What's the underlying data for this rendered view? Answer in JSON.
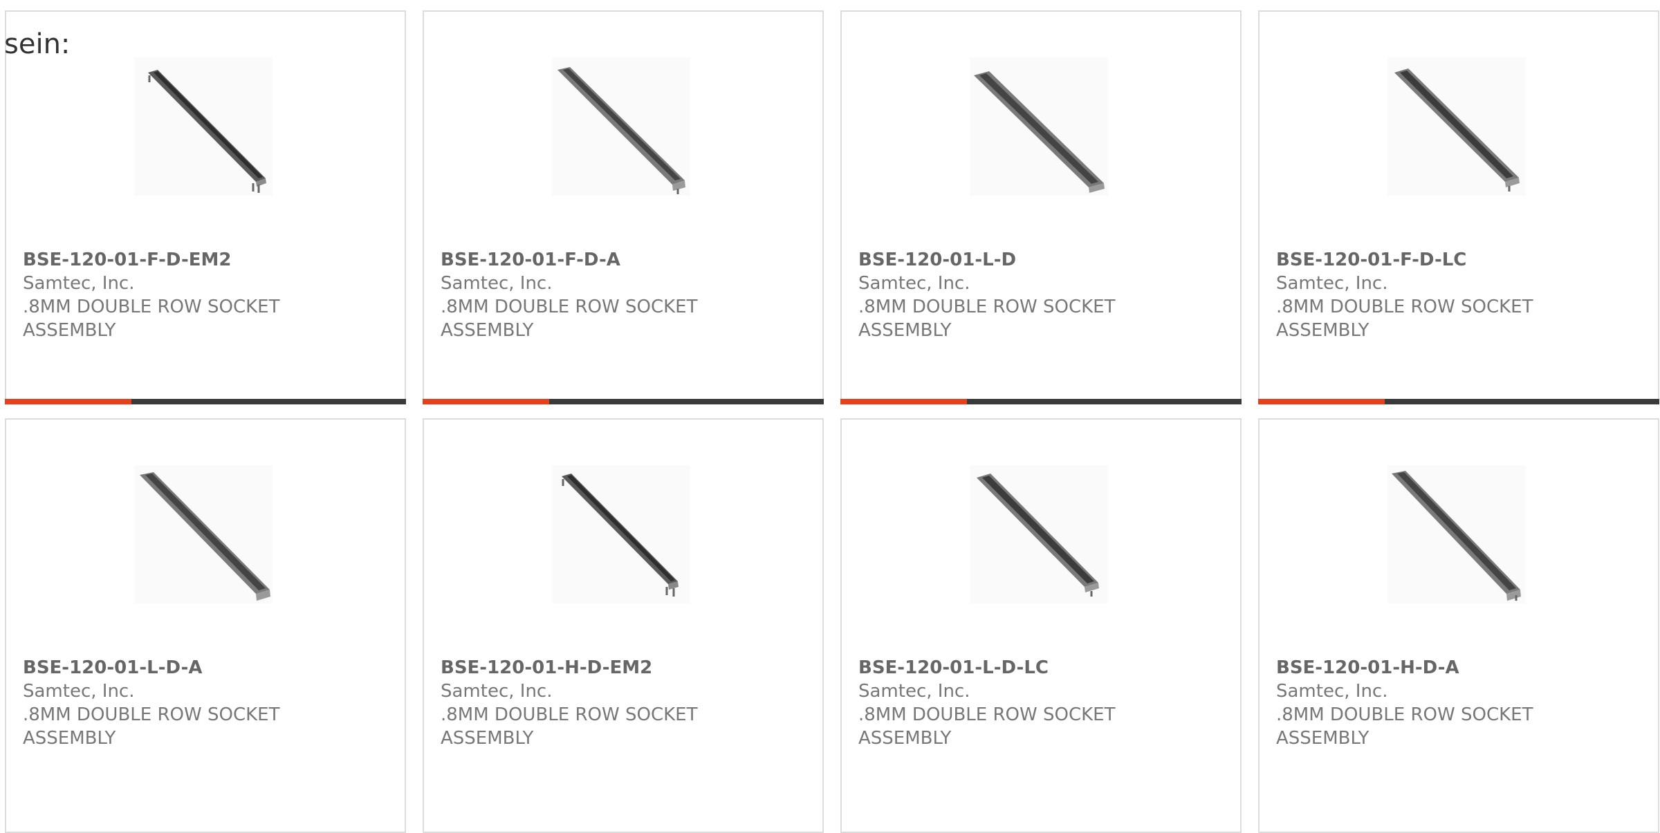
{
  "intro_text": "sein:",
  "accent_color": "#e8401c",
  "bar_color": "#3a3a3a",
  "products": [
    {
      "part_number": "BSE-120-01-F-D-EM2",
      "manufacturer": "Samtec, Inc.",
      "description": ".8MM DOUBLE ROW SOCKET ASSEMBLY",
      "image": "socket-connector-image"
    },
    {
      "part_number": "BSE-120-01-F-D-A",
      "manufacturer": "Samtec, Inc.",
      "description": ".8MM DOUBLE ROW SOCKET ASSEMBLY",
      "image": "socket-connector-image"
    },
    {
      "part_number": "BSE-120-01-L-D",
      "manufacturer": "Samtec, Inc.",
      "description": ".8MM DOUBLE ROW SOCKET ASSEMBLY",
      "image": "socket-connector-image"
    },
    {
      "part_number": "BSE-120-01-F-D-LC",
      "manufacturer": "Samtec, Inc.",
      "description": ".8MM DOUBLE ROW SOCKET ASSEMBLY",
      "image": "socket-connector-image"
    },
    {
      "part_number": "BSE-120-01-L-D-A",
      "manufacturer": "Samtec, Inc.",
      "description": ".8MM DOUBLE ROW SOCKET ASSEMBLY",
      "image": "socket-connector-image"
    },
    {
      "part_number": "BSE-120-01-H-D-EM2",
      "manufacturer": "Samtec, Inc.",
      "description": ".8MM DOUBLE ROW SOCKET ASSEMBLY",
      "image": "socket-connector-image"
    },
    {
      "part_number": "BSE-120-01-L-D-LC",
      "manufacturer": "Samtec, Inc.",
      "description": ".8MM DOUBLE ROW SOCKET ASSEMBLY",
      "image": "socket-connector-image"
    },
    {
      "part_number": "BSE-120-01-H-D-A",
      "manufacturer": "Samtec, Inc.",
      "description": ".8MM DOUBLE ROW SOCKET ASSEMBLY",
      "image": "socket-connector-image"
    }
  ]
}
